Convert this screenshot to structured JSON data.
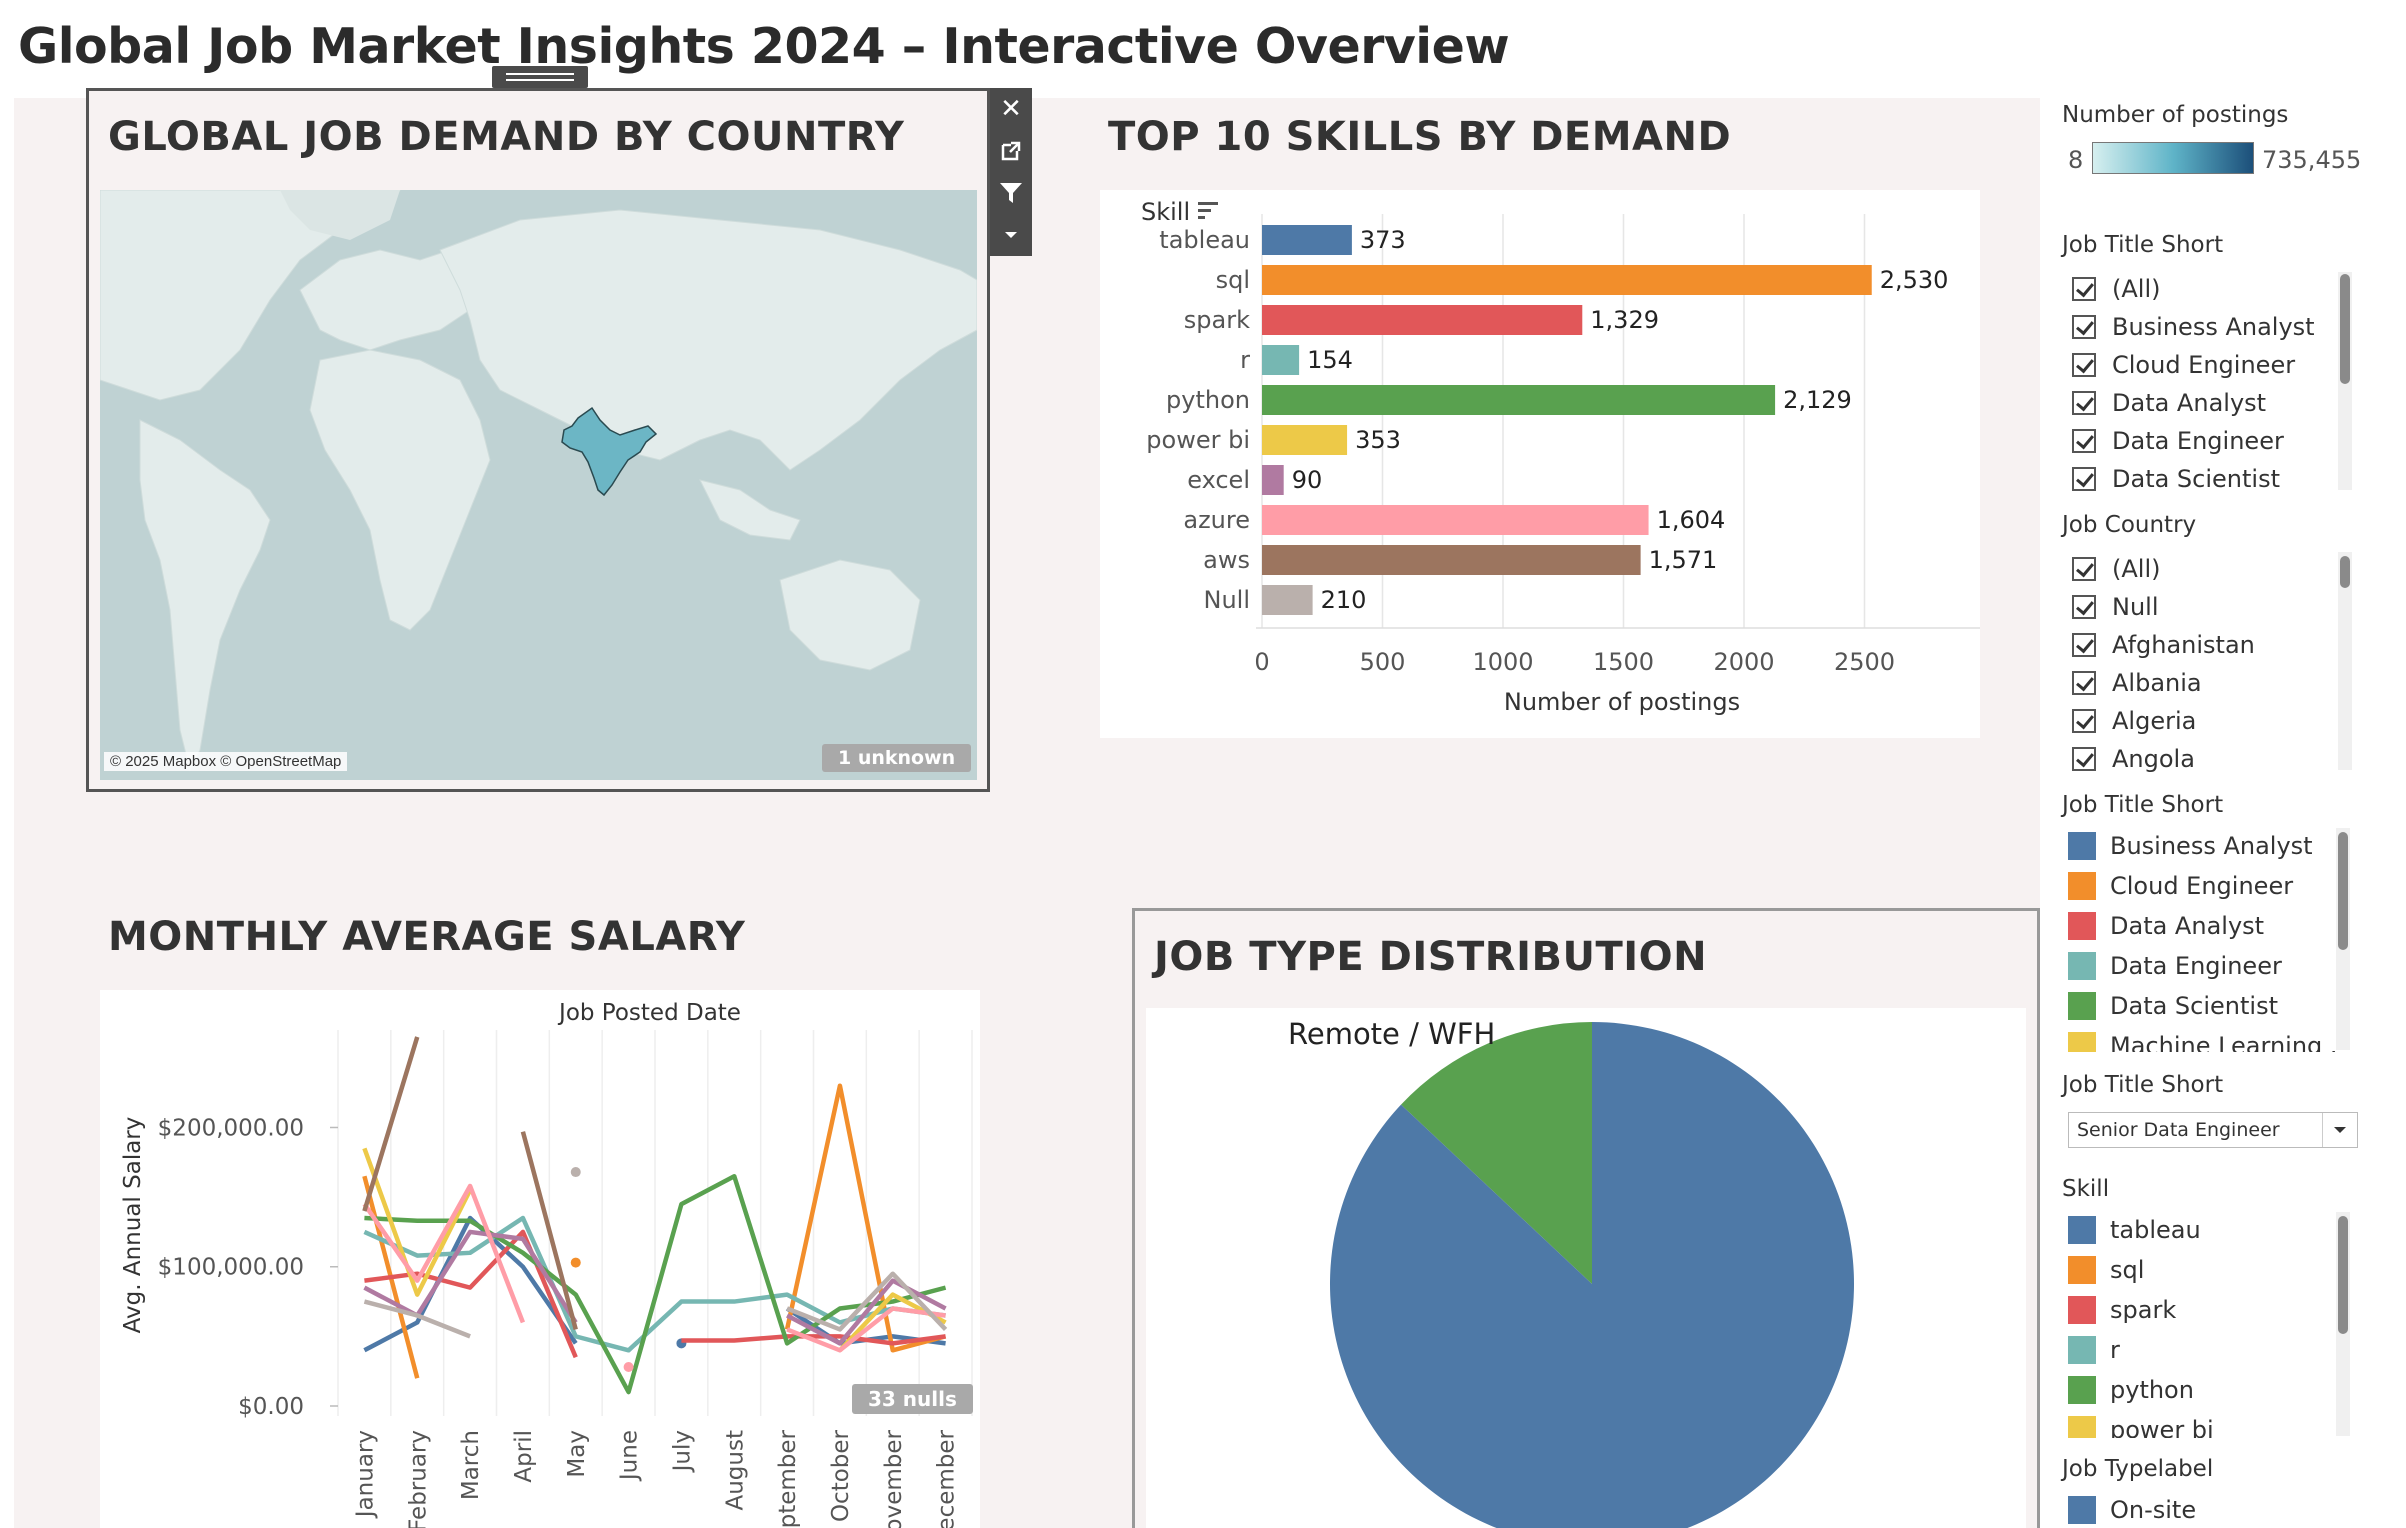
{
  "page_title": "Global Job Market Insights 2024 – Interactive Overview",
  "map": {
    "title": "GLOBAL JOB DEMAND BY COUNTRY",
    "credit": "© 2025 Mapbox © OpenStreetMap",
    "unknown_badge": "1 unknown",
    "highlighted_country": "India",
    "toolbar": {
      "close_icon": "close-icon",
      "popout_icon": "popout-icon",
      "filter_icon": "filter-icon",
      "more_icon": "chevron-down-icon"
    }
  },
  "skills": {
    "title": "TOP 10 SKILLS BY DEMAND",
    "axis_header": "Skill",
    "sort_icon": "sort-icon"
  },
  "salary": {
    "title": "MONTHLY AVERAGE SALARY",
    "nulls_badge": "33 nulls"
  },
  "jobtype": {
    "title": "JOB TYPE DISTRIBUTION"
  },
  "sidebar": {
    "postings_legend": {
      "title": "Number of postings",
      "min": "8",
      "max": "735,455",
      "gradient_from": "#d6efef",
      "gradient_to": "#1c4f7a"
    },
    "job_title_filter": {
      "title": "Job Title Short",
      "items": [
        "(All)",
        "Business Analyst",
        "Cloud Engineer",
        "Data Analyst",
        "Data Engineer",
        "Data Scientist"
      ]
    },
    "job_country_filter": {
      "title": "Job Country",
      "items": [
        "(All)",
        "Null",
        "Afghanistan",
        "Albania",
        "Algeria",
        "Angola"
      ]
    },
    "job_title_legend": {
      "title": "Job Title Short",
      "items": [
        {
          "label": "Business Analyst",
          "color": "#4e79a7"
        },
        {
          "label": "Cloud Engineer",
          "color": "#f28e2b"
        },
        {
          "label": "Data Analyst",
          "color": "#e15759"
        },
        {
          "label": "Data Engineer",
          "color": "#76b7b2"
        },
        {
          "label": "Data Scientist",
          "color": "#59a14f"
        },
        {
          "label": "Machine Learning ...",
          "color": "#edc948"
        }
      ]
    },
    "job_title_dropdown": {
      "title": "Job Title Short",
      "value": "Senior Data Engineer"
    },
    "skill_legend": {
      "title": "Skill",
      "items": [
        {
          "label": "tableau",
          "color": "#4e79a7"
        },
        {
          "label": "sql",
          "color": "#f28e2b"
        },
        {
          "label": "spark",
          "color": "#e15759"
        },
        {
          "label": "r",
          "color": "#76b7b2"
        },
        {
          "label": "python",
          "color": "#59a14f"
        },
        {
          "label": "power bi",
          "color": "#edc948"
        }
      ]
    },
    "job_type_legend": {
      "title": "Job Typelabel",
      "items": [
        {
          "label": "On-site",
          "color": "#4e79a7"
        }
      ]
    }
  },
  "chart_data": [
    {
      "type": "bar",
      "title": "TOP 10 SKILLS BY DEMAND",
      "ylabel": "Skill",
      "xlabel": "Number of postings",
      "categories": [
        "tableau",
        "sql",
        "spark",
        "r",
        "python",
        "power bi",
        "excel",
        "azure",
        "aws",
        "Null"
      ],
      "values": [
        373,
        2530,
        1329,
        154,
        2129,
        353,
        90,
        1604,
        1571,
        210
      ],
      "value_labels": [
        "373",
        "2,530",
        "1,329",
        "154",
        "2,129",
        "353",
        "90",
        "1,604",
        "1,571",
        "210"
      ],
      "colors": [
        "#4e79a7",
        "#f28e2b",
        "#e15759",
        "#76b7b2",
        "#59a14f",
        "#edc948",
        "#b07aa1",
        "#ff9da7",
        "#9c755f",
        "#bab0ac"
      ],
      "xticks": [
        "0",
        "500",
        "1000",
        "1500",
        "2000",
        "2500"
      ],
      "xlim": [
        0,
        3000
      ],
      "grid": true
    },
    {
      "type": "line",
      "title": "Job Posted Date",
      "ylabel": "Avg. Annual Salary",
      "categories": [
        "January",
        "February",
        "March",
        "April",
        "May",
        "June",
        "July",
        "August",
        "September",
        "October",
        "November",
        "December"
      ],
      "yticks": [
        "$200,000.00",
        "$100,000.00",
        "$0.00"
      ],
      "ylim": [
        0,
        270000
      ],
      "series": [
        {
          "color": "#4e79a7",
          "values": [
            40000,
            60000,
            135000,
            100000,
            45000,
            null,
            45000,
            null,
            70000,
            45000,
            50000,
            45000
          ]
        },
        {
          "color": "#f28e2b",
          "values": [
            165000,
            20000,
            null,
            null,
            103000,
            null,
            null,
            null,
            55000,
            230000,
            40000,
            50000
          ]
        },
        {
          "color": "#e15759",
          "values": [
            90000,
            95000,
            85000,
            125000,
            35000,
            null,
            47000,
            47000,
            50000,
            50000,
            45000,
            50000
          ]
        },
        {
          "color": "#76b7b2",
          "values": [
            125000,
            108000,
            110000,
            135000,
            50000,
            40000,
            75000,
            75000,
            80000,
            60000,
            70000,
            65000
          ]
        },
        {
          "color": "#59a14f",
          "values": [
            135000,
            133000,
            133000,
            110000,
            80000,
            10000,
            145000,
            165000,
            45000,
            70000,
            75000,
            85000
          ]
        },
        {
          "color": "#edc948",
          "values": [
            185000,
            80000,
            155000,
            null,
            null,
            null,
            null,
            null,
            null,
            40000,
            80000,
            60000
          ]
        },
        {
          "color": "#b07aa1",
          "values": [
            85000,
            65000,
            125000,
            120000,
            60000,
            null,
            null,
            null,
            65000,
            45000,
            90000,
            70000
          ]
        },
        {
          "color": "#ff9da7",
          "values": [
            145000,
            90000,
            158000,
            60000,
            null,
            28000,
            null,
            null,
            55000,
            40000,
            70000,
            65000
          ]
        },
        {
          "color": "#9c755f",
          "values": [
            140000,
            265000,
            null,
            197000,
            55000,
            null,
            null,
            null,
            null,
            null,
            null,
            null
          ]
        },
        {
          "color": "#bab0ac",
          "values": [
            75000,
            65000,
            50000,
            null,
            168000,
            null,
            null,
            null,
            70000,
            55000,
            95000,
            55000
          ]
        }
      ]
    },
    {
      "type": "pie",
      "title": "JOB TYPE DISTRIBUTION",
      "labels": [
        "Remote / WFH",
        "On-site"
      ],
      "values": [
        13,
        87
      ],
      "colors": [
        "#59a14f",
        "#4e79a7"
      ]
    }
  ]
}
